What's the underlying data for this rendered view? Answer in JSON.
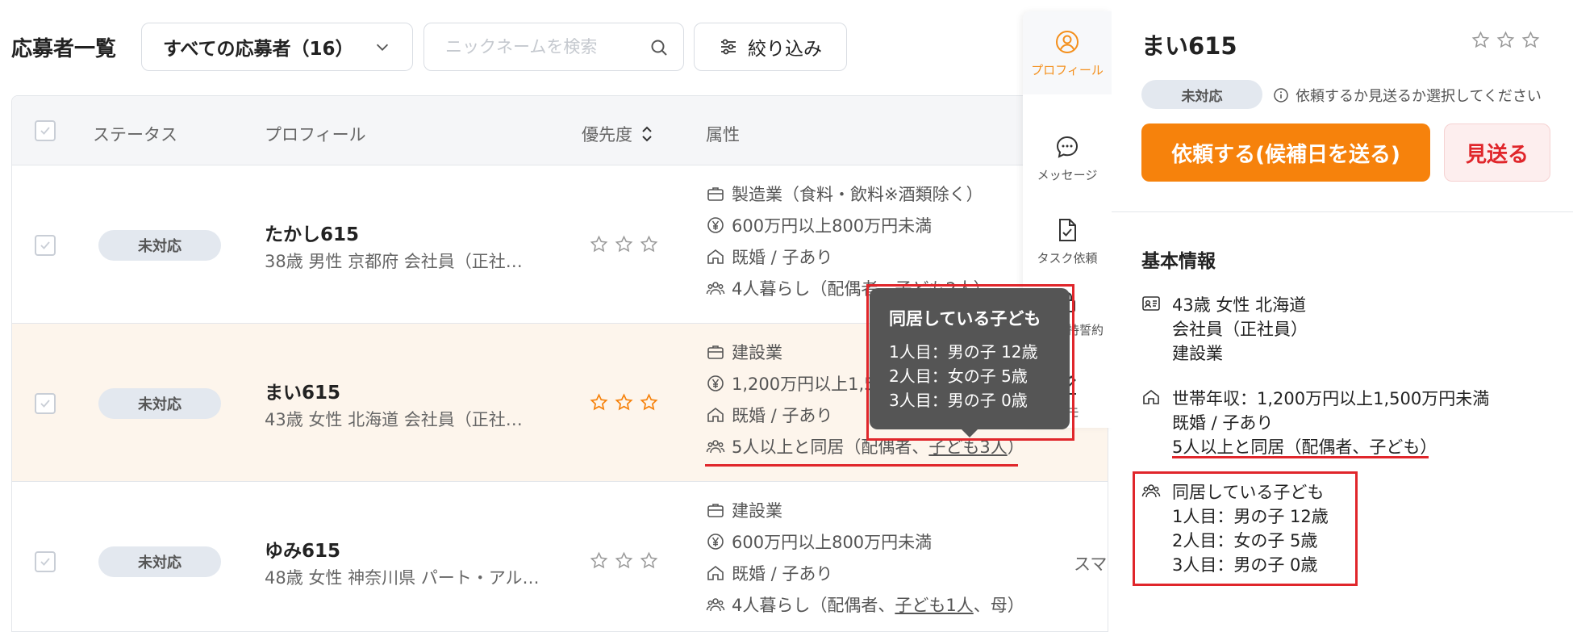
{
  "header": {
    "title": "応募者一覧",
    "filter_select": "すべての応募者（16）",
    "search_placeholder": "ニックネームを検索",
    "refine_label": "絞り込み"
  },
  "table": {
    "columns": {
      "status": "ステータス",
      "profile": "プロフィール",
      "priority": "優先度",
      "attributes": "属性"
    },
    "rows": [
      {
        "status": "未対応",
        "name": "たかし615",
        "summary": "38歳 男性 京都府 会社員（正社…",
        "industry": "製造業（食料・飲料※酒類除く）",
        "income": "600万円以上800万円未満",
        "family": "既婚 / 子あり",
        "household_prefix": "4人暮らし（配偶者、",
        "household_link": "子ども2人",
        "household_suffix": "）",
        "rating": 0
      },
      {
        "status": "未対応",
        "name": "まい615",
        "summary": "43歳 女性 北海道 会社員（正社…",
        "industry": "建設業",
        "income": "1,200万円以上1,500万円未満",
        "family": "既婚 / 子あり",
        "household_prefix": "5人以上と同居（配偶者、",
        "household_link": "子ども3人",
        "household_suffix": "）",
        "rating": 0
      },
      {
        "status": "未対応",
        "name": "ゆみ615",
        "summary": "48歳 女性 神奈川県 パート・アル…",
        "industry": "建設業",
        "income": "600万円以上800万円未満",
        "family": "既婚 / 子あり",
        "household_prefix": "4人暮らし（配偶者、",
        "household_link": "子ども1人",
        "household_suffix": "、母）",
        "extra": "スマー",
        "rating": 0
      }
    ]
  },
  "tooltip": {
    "title": "同居している子ども",
    "lines": [
      "1人目：男の子 12歳",
      "2人目：女の子 5歳",
      "3人目：男の子 0歳"
    ]
  },
  "side_tabs": [
    "プロフィール",
    "メッセージ",
    "タスク依頼",
    "秘密保持誓約",
    "メモ"
  ],
  "panel": {
    "name": "まい615",
    "status": "未対応",
    "hint": "依頼するか見送るか選択してください",
    "request_label": "依頼する(候補日を送る)",
    "decline_label": "見送る",
    "section_title": "基本情報",
    "profile_lines": [
      "43歳 女性 北海道",
      "会社員（正社員）",
      "建設業"
    ],
    "income_lines": [
      "世帯年収：1,200万円以上1,500万円未満",
      "既婚 / 子あり",
      "5人以上と同居（配偶者、子ども）"
    ],
    "children_lines": [
      "同居している子ども",
      "1人目：男の子 12歳",
      "2人目：女の子 5歳",
      "3人目：男の子 0歳"
    ]
  },
  "colors": {
    "accent": "#f6820c",
    "danger": "#e0262b",
    "pill": "#e3e8ef"
  }
}
